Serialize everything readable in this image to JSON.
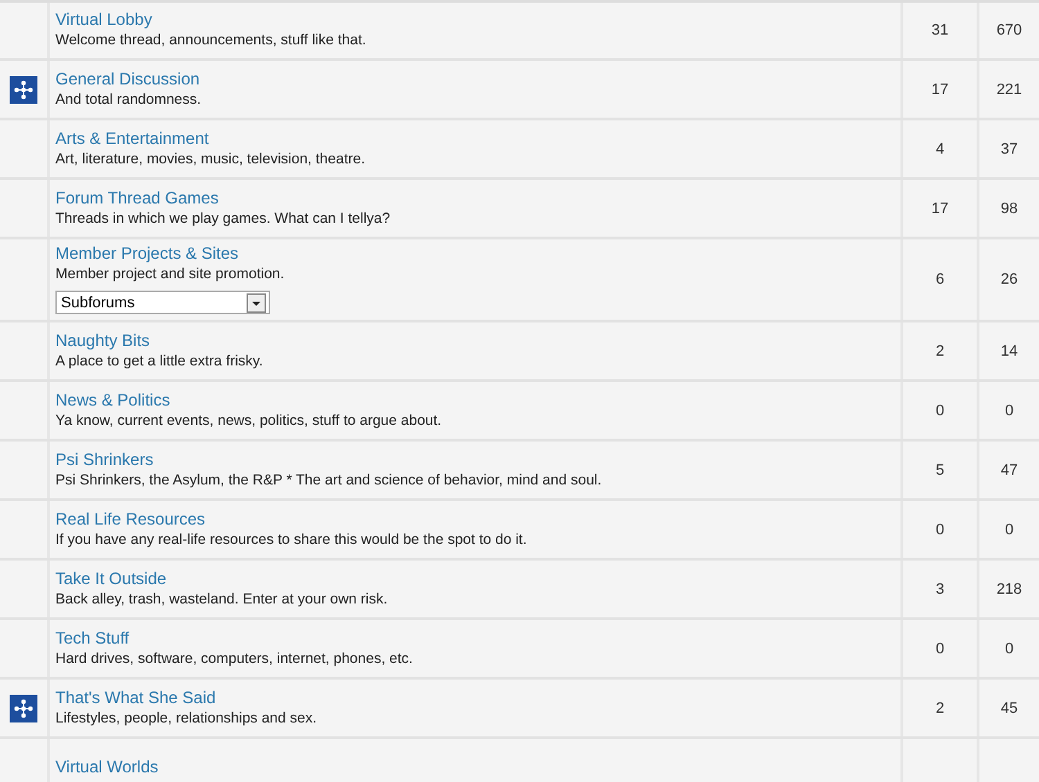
{
  "forums": [
    {
      "title": "Virtual Lobby",
      "description": "Welcome thread, announcements, stuff like that.",
      "icon": false,
      "threads": "31",
      "posts": "670"
    },
    {
      "title": "General Discussion",
      "description": "And total randomness.",
      "icon": true,
      "threads": "17",
      "posts": "221"
    },
    {
      "title": "Arts & Entertainment",
      "description": "Art, literature, movies, music, television, theatre.",
      "icon": false,
      "threads": "4",
      "posts": "37"
    },
    {
      "title": "Forum Thread Games",
      "description": "Threads in which we play games. What can I tellya?",
      "icon": false,
      "threads": "17",
      "posts": "98"
    },
    {
      "title": "Member Projects & Sites",
      "description": "Member project and site promotion.",
      "icon": false,
      "threads": "6",
      "posts": "26",
      "subforums": {
        "value": "Subforums"
      }
    },
    {
      "title": "Naughty Bits",
      "description": "A place to get a little extra frisky.",
      "icon": false,
      "threads": "2",
      "posts": "14"
    },
    {
      "title": "News & Politics",
      "description": "Ya know, current events, news, politics, stuff to argue about.",
      "icon": false,
      "threads": "0",
      "posts": "0"
    },
    {
      "title": "Psi Shrinkers",
      "description": "Psi Shrinkers, the Asylum, the R&P * The art and science of behavior, mind and soul.",
      "icon": false,
      "threads": "5",
      "posts": "47"
    },
    {
      "title": "Real Life Resources",
      "description": "If you have any real-life resources to share this would be the spot to do it.",
      "icon": false,
      "threads": "0",
      "posts": "0"
    },
    {
      "title": "Take It Outside",
      "description": "Back alley, trash, wasteland. Enter at your own risk.",
      "icon": false,
      "threads": "3",
      "posts": "218"
    },
    {
      "title": "Tech Stuff",
      "description": "Hard drives, software, computers, internet, phones, etc.",
      "icon": false,
      "threads": "0",
      "posts": "0"
    },
    {
      "title": "That's What She Said",
      "description": "Lifestyles, people, relationships and sex.",
      "icon": true,
      "threads": "2",
      "posts": "45"
    },
    {
      "title": "Virtual Worlds",
      "icon": false
    }
  ]
}
